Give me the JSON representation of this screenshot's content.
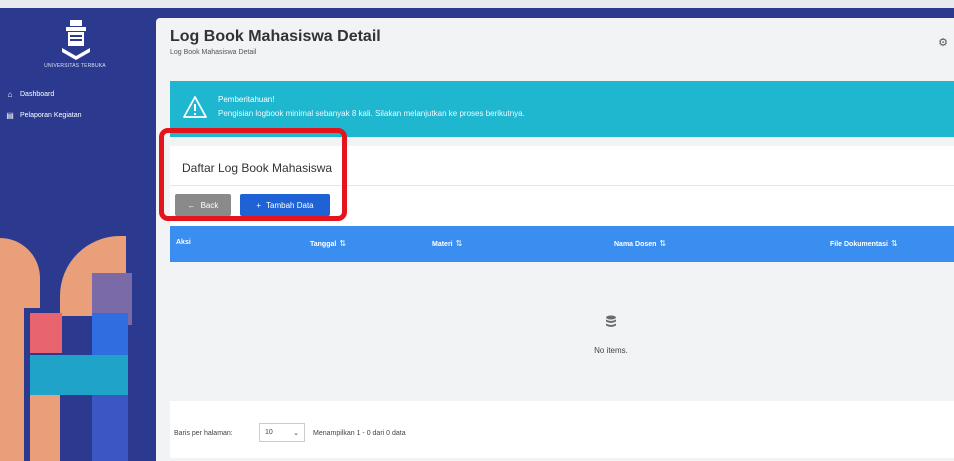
{
  "sidebar": {
    "logo_text": "UNIVERSITAS TERBUKA",
    "items": [
      {
        "label": "Dashboard",
        "icon": "home-icon"
      },
      {
        "label": "Pelaporan Kegiatan",
        "icon": "document-icon"
      }
    ]
  },
  "header": {
    "title": "Log Book Mahasiswa Detail",
    "subtitle": "Log Book Mahasiswa Detail"
  },
  "alert": {
    "title": "Pemberitahuan!",
    "message": "Pengisian logbook minimal sebanyak 8 kali. Silakan melanjutkan ke proses berikutnya.",
    "icon": "warning-icon",
    "color": "#1fb6cf"
  },
  "panel": {
    "title": "Daftar Log Book Mahasiswa",
    "back_label": "Back",
    "add_label": "Tambah Data"
  },
  "table": {
    "columns": [
      {
        "label": "Aksi",
        "sortable": false
      },
      {
        "label": "Tanggal",
        "sortable": true
      },
      {
        "label": "Materi",
        "sortable": true
      },
      {
        "label": "Nama Dosen",
        "sortable": true
      },
      {
        "label": "File Dokumentasi",
        "sortable": true
      }
    ],
    "sort_glyph": "⇅",
    "empty_text": "No items.",
    "header_color": "#3a8ef0"
  },
  "footer": {
    "rows_label": "Baris per halaman:",
    "rows_value": "10",
    "info": "Menampilkan 1 - 0 dari 0 data"
  },
  "colors": {
    "sidebar": "#2b3a8f",
    "primary_button": "#1f62d6",
    "back_button": "#8a8a8a",
    "highlight": "#e4141c"
  }
}
